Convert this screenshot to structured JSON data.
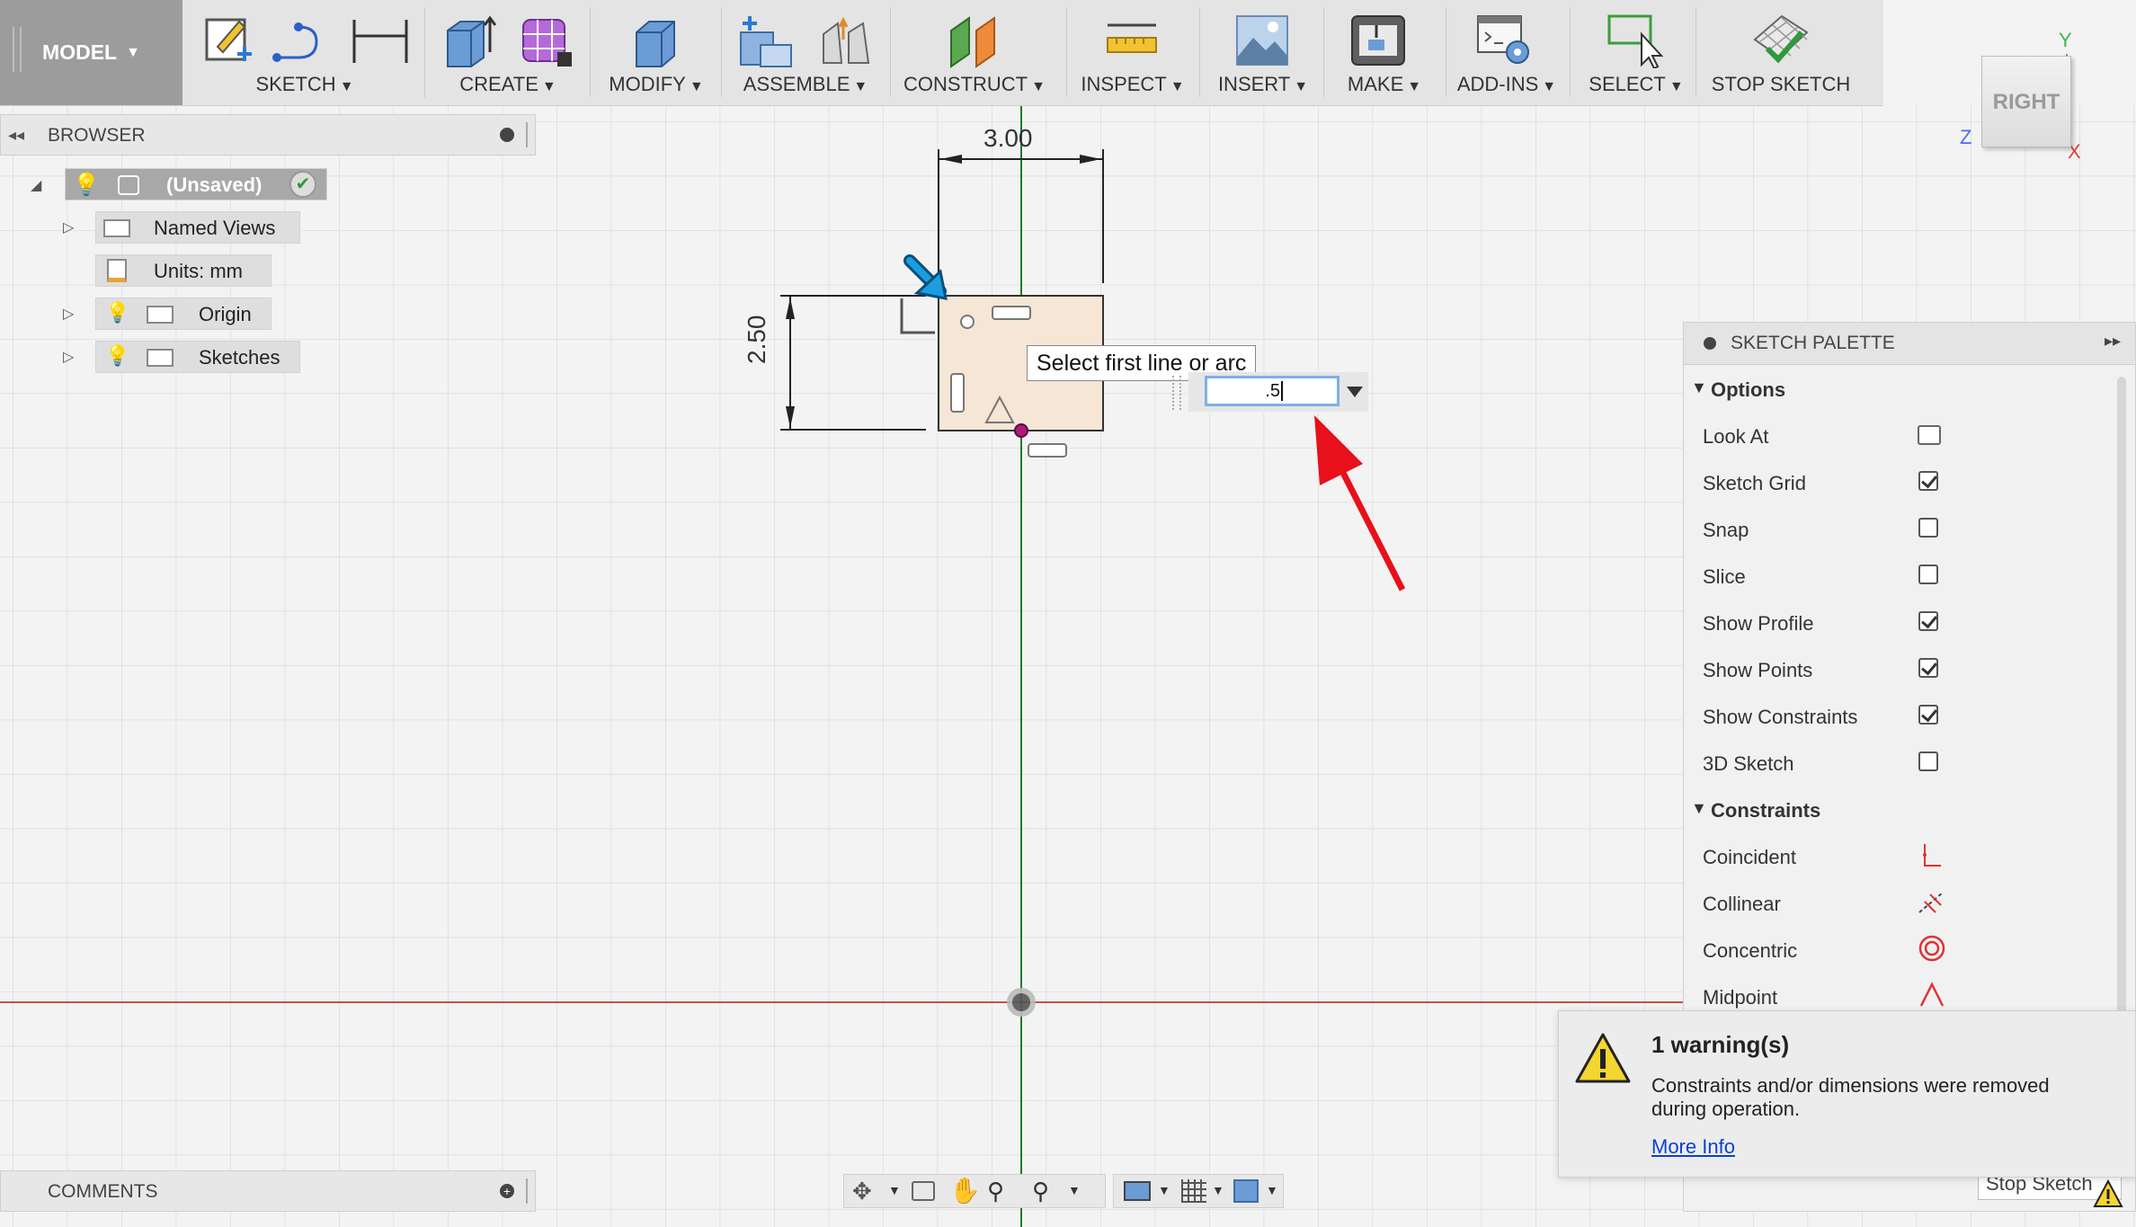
{
  "toolbar": {
    "model_label": "MODEL",
    "groups": [
      {
        "label": "SKETCH"
      },
      {
        "label": "CREATE"
      },
      {
        "label": "MODIFY"
      },
      {
        "label": "ASSEMBLE"
      },
      {
        "label": "CONSTRUCT"
      },
      {
        "label": "INSPECT"
      },
      {
        "label": "INSERT"
      },
      {
        "label": "MAKE"
      },
      {
        "label": "ADD-INS"
      },
      {
        "label": "SELECT"
      },
      {
        "label": "STOP SKETCH"
      }
    ]
  },
  "browser": {
    "title": "BROWSER",
    "items": [
      {
        "label": "(Unsaved)"
      },
      {
        "label": "Named Views"
      },
      {
        "label": "Units: mm"
      },
      {
        "label": "Origin"
      },
      {
        "label": "Sketches"
      }
    ]
  },
  "comments": {
    "title": "COMMENTS"
  },
  "canvas": {
    "dim_width": "3.00",
    "dim_height": "2.50",
    "tooltip": "Select first line or arc",
    "input_value": ".5"
  },
  "viewcube": {
    "face": "RIGHT",
    "axis_y": "Y",
    "axis_z": "Z",
    "axis_x": "X"
  },
  "palette": {
    "title": "SKETCH PALETTE",
    "options_header": "Options",
    "options": [
      {
        "label": "Look At",
        "type": "icon"
      },
      {
        "label": "Sketch Grid",
        "checked": true
      },
      {
        "label": "Snap",
        "checked": false
      },
      {
        "label": "Slice",
        "checked": false
      },
      {
        "label": "Show Profile",
        "checked": true
      },
      {
        "label": "Show Points",
        "checked": true
      },
      {
        "label": "Show Constraints",
        "checked": true
      },
      {
        "label": "3D Sketch",
        "checked": false
      }
    ],
    "constraints_header": "Constraints",
    "constraints": [
      {
        "label": "Coincident"
      },
      {
        "label": "Collinear"
      },
      {
        "label": "Concentric"
      },
      {
        "label": "Midpoint"
      }
    ],
    "stop_button": "Stop Sketch"
  },
  "warning": {
    "title": "1 warning(s)",
    "message_line1": "Constraints and/or dimensions were removed",
    "message_line2": "during operation.",
    "link": "More Info"
  },
  "colors": {
    "x_axis": "#d04a4a",
    "y_axis": "#2e8b3a",
    "accent_blue": "#1a8fd6",
    "arrow_red": "#e8101a",
    "profile_fill": "#f5e6d6"
  }
}
